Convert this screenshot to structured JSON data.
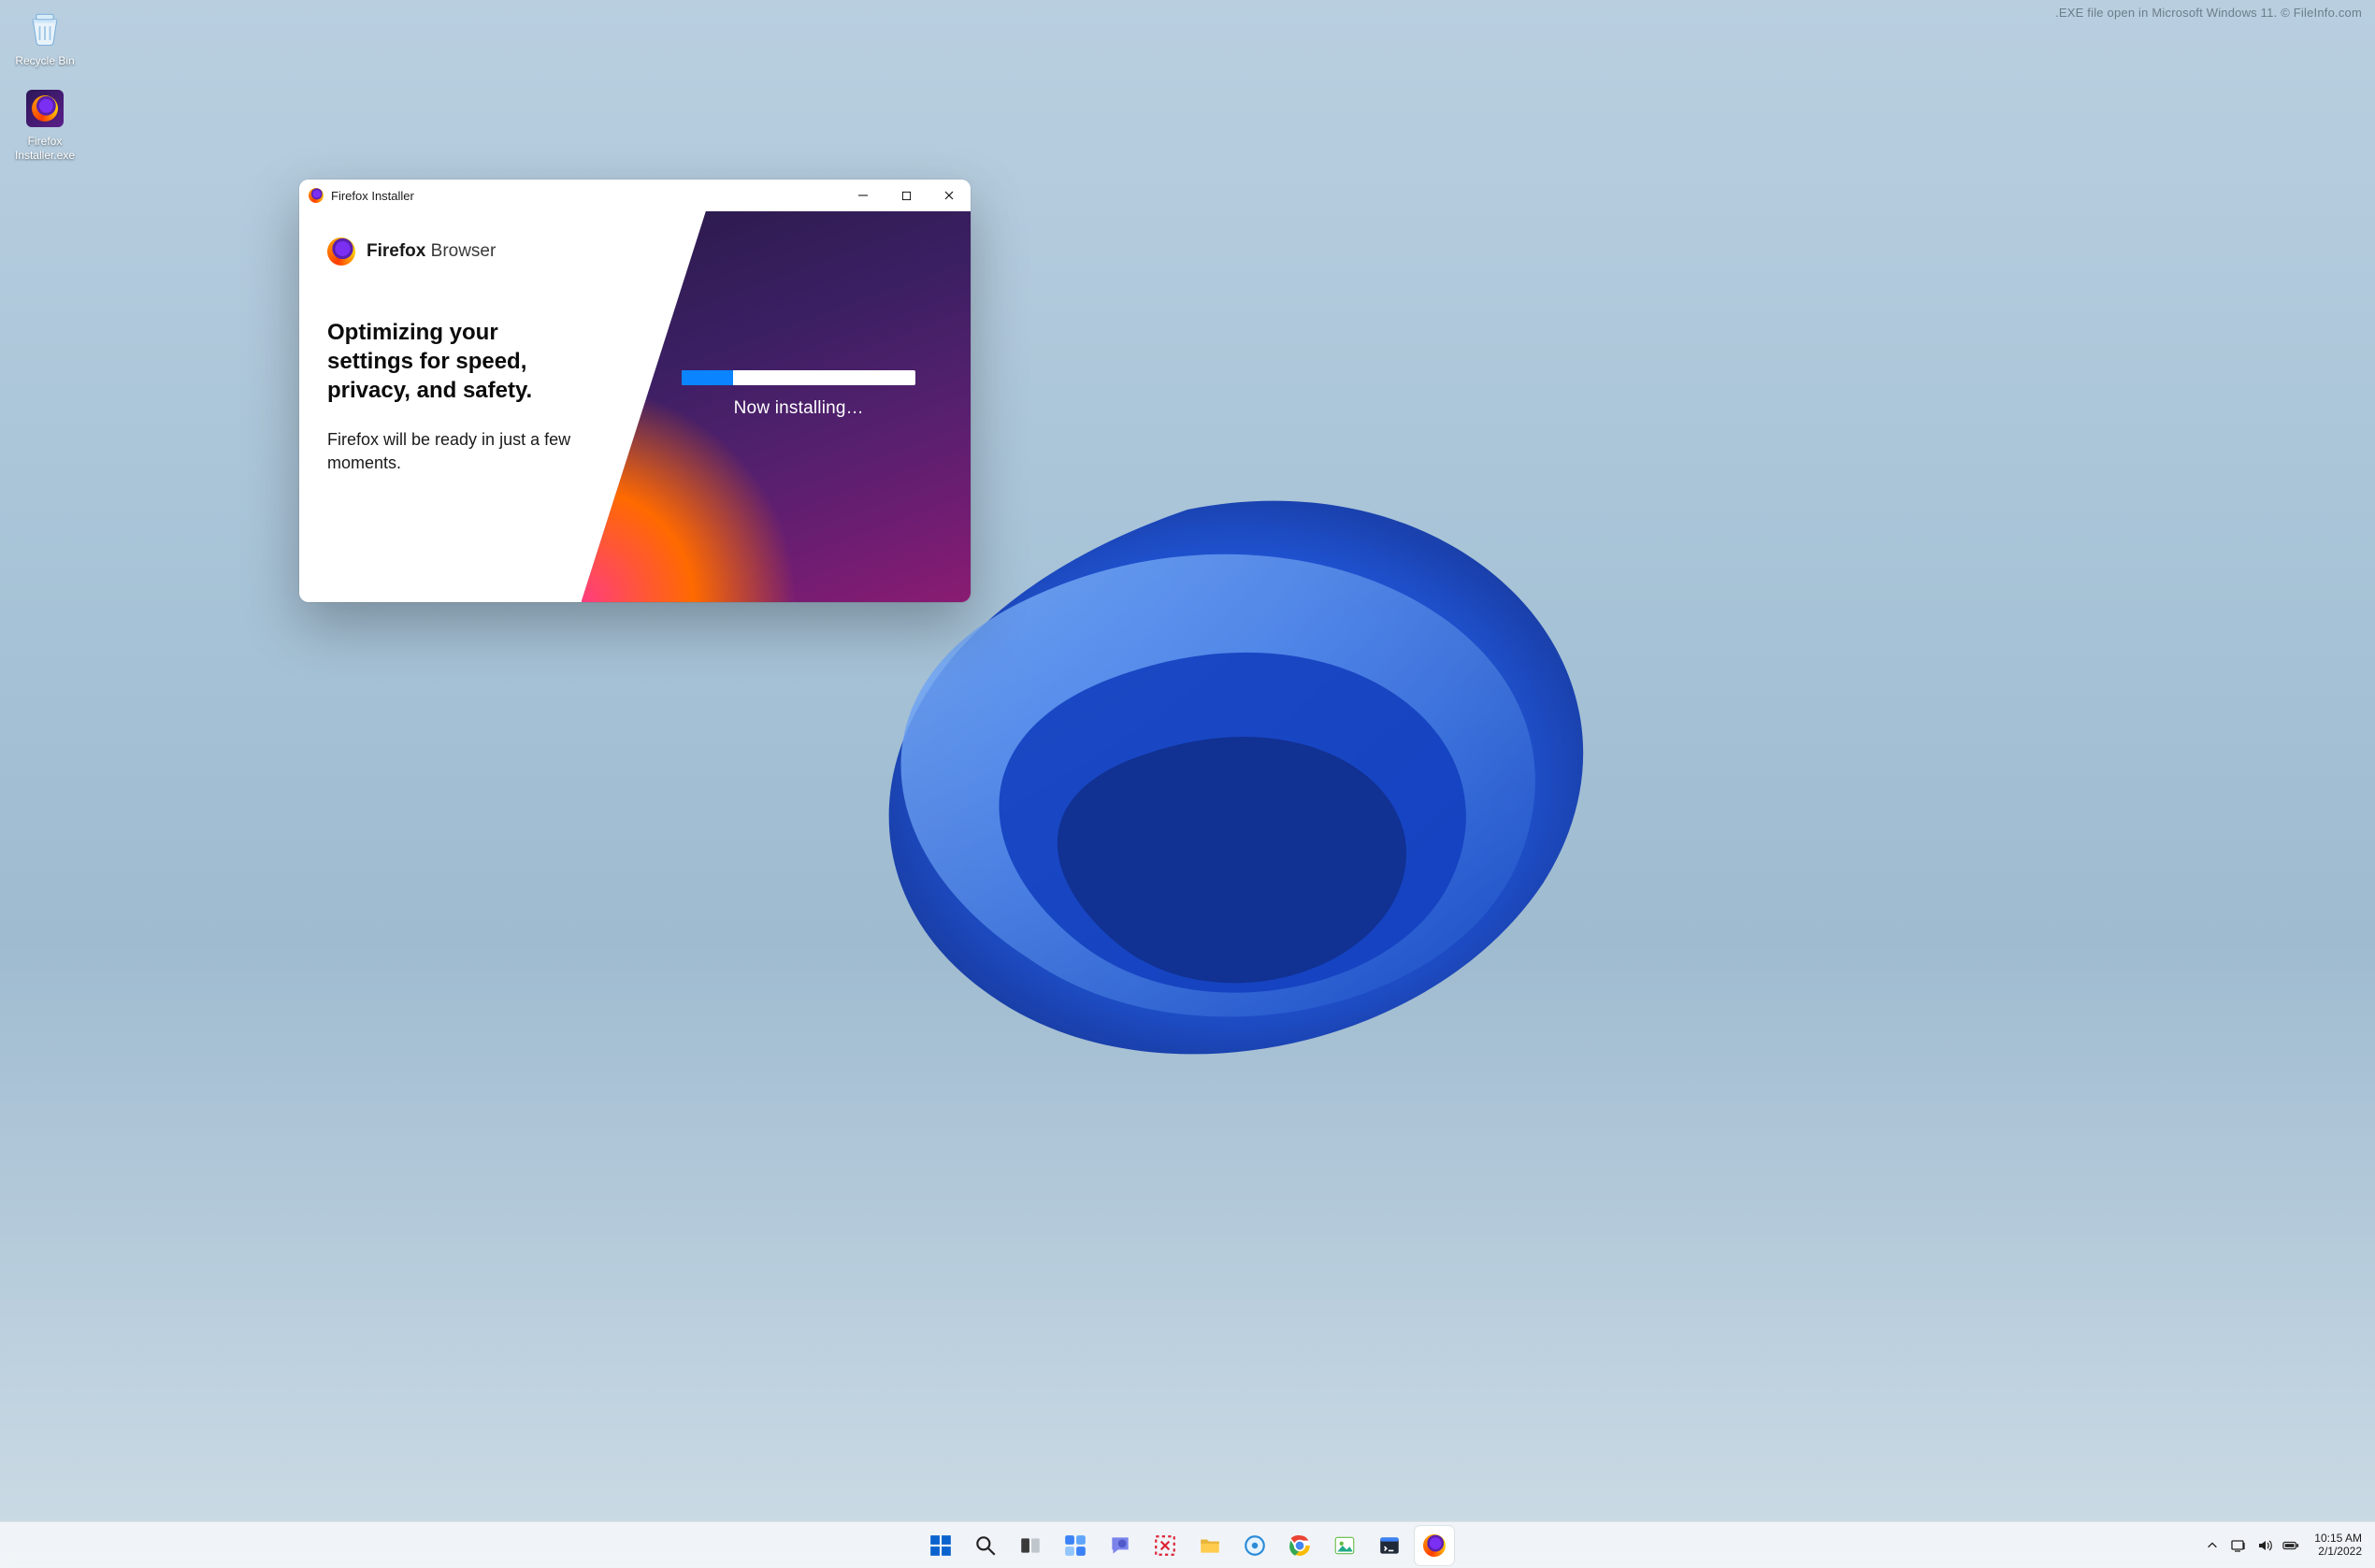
{
  "watermark": ".EXE file open in Microsoft Windows 11. © FileInfo.com",
  "desktop": {
    "icons": [
      {
        "name": "recycle-bin",
        "label": "Recycle Bin"
      },
      {
        "name": "firefox-installer",
        "label": "Firefox Installer.exe"
      }
    ]
  },
  "window": {
    "title": "Firefox Installer",
    "brand_bold": "Firefox",
    "brand_thin": "Browser",
    "headline": "Optimizing your settings for speed, privacy, and safety.",
    "subtext": "Firefox will be ready in just a few moments.",
    "progress_percent": 22,
    "progress_label": "Now installing…"
  },
  "taskbar": {
    "items": [
      {
        "name": "start",
        "label": "Start"
      },
      {
        "name": "search",
        "label": "Search"
      },
      {
        "name": "task-view",
        "label": "Task View"
      },
      {
        "name": "widgets",
        "label": "Widgets"
      },
      {
        "name": "chat",
        "label": "Chat"
      },
      {
        "name": "snip",
        "label": "Snipping Tool"
      },
      {
        "name": "file-explorer",
        "label": "File Explorer"
      },
      {
        "name": "tips",
        "label": "Tips"
      },
      {
        "name": "chrome",
        "label": "Google Chrome"
      },
      {
        "name": "photos",
        "label": "Photos"
      },
      {
        "name": "cmd",
        "label": "Terminal"
      },
      {
        "name": "firefox-installer-task",
        "label": "Firefox Installer",
        "active": true
      }
    ]
  },
  "systray": {
    "chevron": "˄",
    "time": "10:15 AM",
    "date": "2/1/2022"
  }
}
